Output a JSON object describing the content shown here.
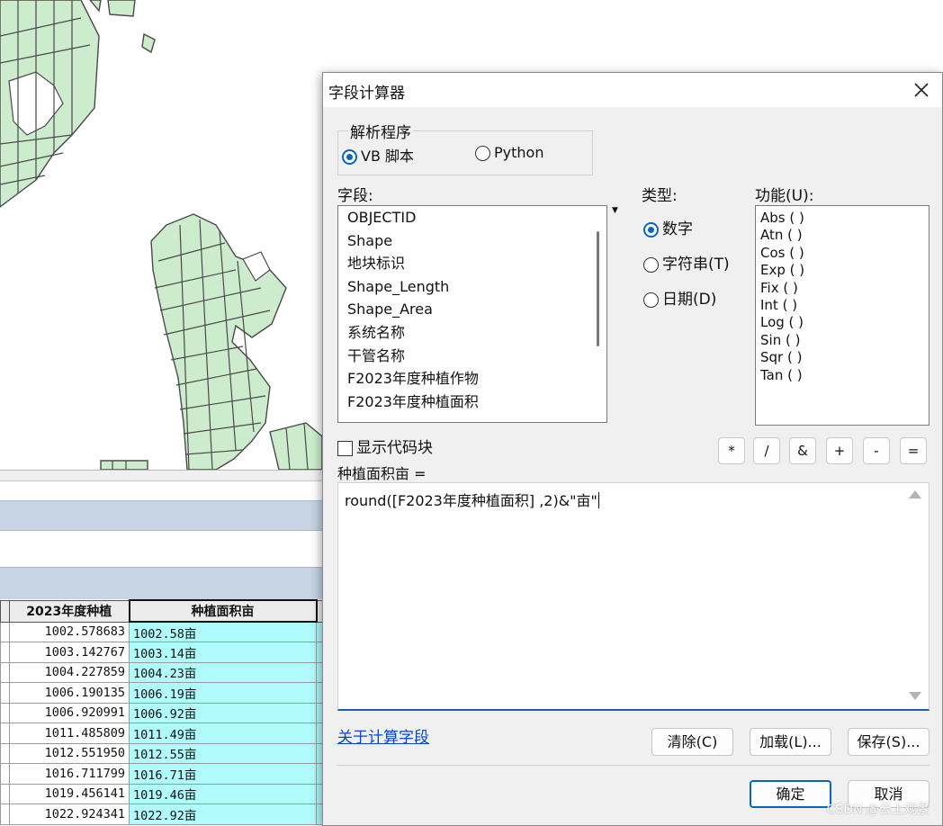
{
  "dialog": {
    "title": "字段计算器",
    "parser": {
      "legend": "解析程序",
      "options": [
        "VB 脚本",
        "Python"
      ],
      "selected": "VB 脚本"
    },
    "fields_label": "字段:",
    "fields": [
      "OBJECTID",
      "Shape",
      "地块标识",
      "Shape_Length",
      "Shape_Area",
      "系统名称",
      "干管名称",
      "F2023年度种植作物",
      "F2023年度种植面积"
    ],
    "type_label": "类型:",
    "types": [
      "数字",
      "字符串(T)",
      "日期(D)"
    ],
    "selected_type": "数字",
    "functions_label": "功能(U):",
    "functions": [
      "Abs ( )",
      "Atn ( )",
      "Cos ( )",
      "Exp ( )",
      "Fix ( )",
      "Int ( )",
      "Log ( )",
      "Sin ( )",
      "Sqr ( )",
      "Tan ( )"
    ],
    "show_codeblock": "显示代码块",
    "show_codeblock_checked": false,
    "operators": [
      "*",
      "/",
      "&",
      "+",
      "-",
      "="
    ],
    "expression_label": "种植面积亩 =",
    "expression": "round([F2023年度种植面积] ,2)&\"亩\"",
    "help_link": "关于计算字段",
    "buttons": {
      "clear": "清除(C)",
      "load": "加载(L)...",
      "save": "保存(S)...",
      "ok": "确定",
      "cancel": "取消"
    }
  },
  "table": {
    "headers": [
      "",
      "2023年度种植",
      "种植面积亩",
      ""
    ],
    "rows": [
      [
        "1002.578683",
        "1002.58亩"
      ],
      [
        "1003.142767",
        "1003.14亩"
      ],
      [
        "1004.227859",
        "1004.23亩"
      ],
      [
        "1006.190135",
        "1006.19亩"
      ],
      [
        "1006.920991",
        "1006.92亩"
      ],
      [
        "1011.485809",
        "1011.49亩"
      ],
      [
        "1012.551950",
        "1012.55亩"
      ],
      [
        "1016.711799",
        "1016.71亩"
      ],
      [
        "1019.456141",
        "1019.46亩"
      ],
      [
        "1022.924341",
        "1022.92亩"
      ]
    ]
  },
  "colors": {
    "map_polygon_fill": "#cdeccd",
    "map_polygon_stroke": "#4a4a4a",
    "calculated_cell": "#b0fbfb",
    "accent": "#0b63c5"
  },
  "icons": [
    "close-icon",
    "radio-icon",
    "checkbox-icon",
    "scroll-up-arrow-icon",
    "scroll-down-arrow-icon",
    "dropdown-arrow-icon"
  ],
  "watermark": "CSDN @云上观景"
}
